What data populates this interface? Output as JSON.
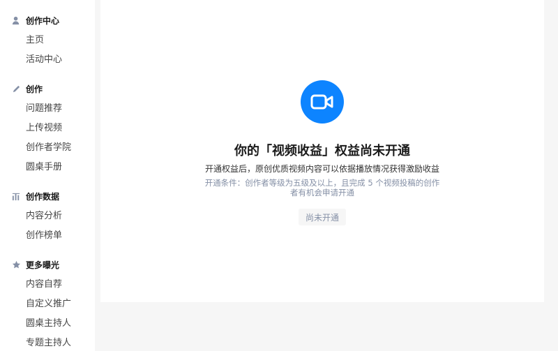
{
  "sidebar": {
    "sections": [
      {
        "title": "创作中心",
        "icon": "user-icon",
        "items": [
          "主页",
          "活动中心"
        ]
      },
      {
        "title": "创作",
        "icon": "pencil-icon",
        "items": [
          "问题推荐",
          "上传视频",
          "创作者学院",
          "圆桌手册"
        ]
      },
      {
        "title": "创作数据",
        "icon": "bar-chart-icon",
        "items": [
          "内容分析",
          "创作榜单"
        ]
      },
      {
        "title": "更多曝光",
        "icon": "star-icon",
        "items": [
          "内容自荐",
          "自定义推广",
          "圆桌主持人",
          "专题主持人"
        ]
      }
    ]
  },
  "main": {
    "icon": "video-camera-icon",
    "headline": "你的「视频收益」权益尚未开通",
    "description": "开通权益后，原创优质视频内容可以依据播放情况获得激励收益",
    "conditions": "开通条件：创作者等级为五级及以上，且完成 5 个视频投稿的创作者有机会申请开通",
    "button_label": "尚未开通"
  },
  "colors": {
    "accent": "#0d84ff",
    "muted": "#8590a6"
  }
}
